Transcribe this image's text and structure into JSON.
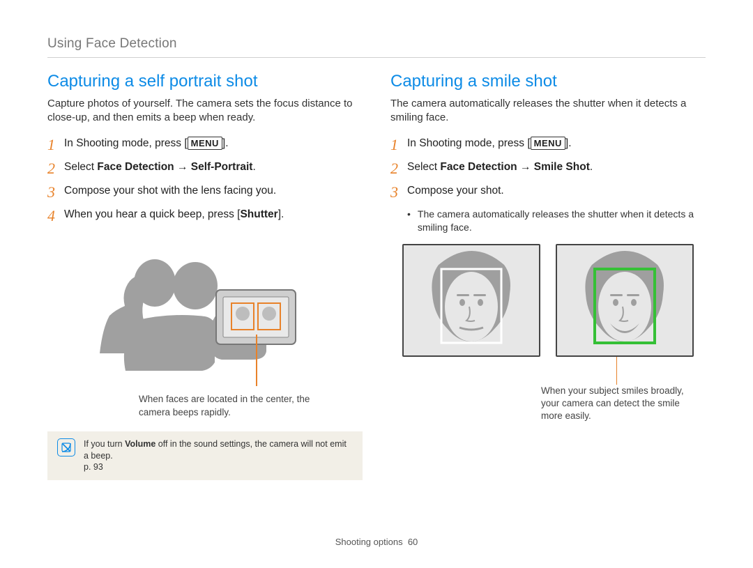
{
  "header": {
    "breadcrumb": "Using Face Detection"
  },
  "left": {
    "title": "Capturing a self portrait shot",
    "intro": "Capture photos of yourself. The camera sets the focus distance to close-up, and then emits a beep when ready.",
    "steps": {
      "s1_pre": "In Shooting mode, press [",
      "s1_menu": "MENU",
      "s1_post": "].",
      "s2_pre": "Select ",
      "s2_bold": "Face Detection → Self-Portrait",
      "s2_post": ".",
      "s3": "Compose your shot with the lens facing you.",
      "s4_pre": "When you hear a quick beep, press [",
      "s4_bold": "Shutter",
      "s4_post": "]."
    },
    "caption": "When faces are located in the center, the camera beeps rapidly.",
    "note_pre": "If you turn ",
    "note_bold": "Volume",
    "note_mid": " off in the sound settings, the camera will not emit a beep. ",
    "note_ref": "p. 93"
  },
  "right": {
    "title": "Capturing a smile shot",
    "intro": "The camera automatically releases the shutter when it detects a smiling face.",
    "steps": {
      "s1_pre": "In Shooting mode, press [",
      "s1_menu": "MENU",
      "s1_post": "].",
      "s2_pre": "Select ",
      "s2_bold": "Face Detection → Smile Shot",
      "s2_post": ".",
      "s3": "Compose your shot.",
      "s3_sub": "The camera automatically releases the shutter when it detects a smiling face."
    },
    "caption": "When your subject smiles broadly, your camera can detect the smile more easily."
  },
  "nums": {
    "n1": "1",
    "n2": "2",
    "n3": "3",
    "n4": "4"
  },
  "footer": {
    "section": "Shooting options",
    "page": "60"
  },
  "colors": {
    "accent_blue": "#0d8be6",
    "accent_orange": "#e8822a",
    "note_bg": "#f2efe7"
  }
}
